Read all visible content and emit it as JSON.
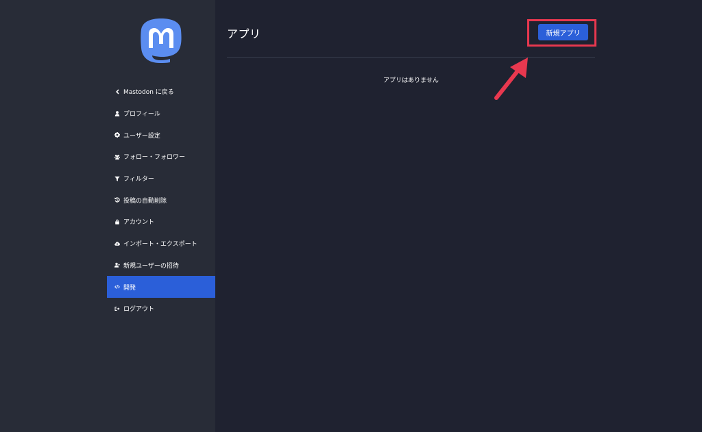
{
  "sidebar": {
    "logo_icon": "mastodon-logo-icon",
    "items": [
      {
        "label": "Mastodon に戻る",
        "icon": "chevron-left-icon",
        "active": false
      },
      {
        "label": "プロフィール",
        "icon": "user-icon",
        "active": false
      },
      {
        "label": "ユーザー設定",
        "icon": "gear-icon",
        "active": false
      },
      {
        "label": "フォロー・フォロワー",
        "icon": "users-icon",
        "active": false
      },
      {
        "label": "フィルター",
        "icon": "filter-icon",
        "active": false
      },
      {
        "label": "投稿の自動削除",
        "icon": "history-icon",
        "active": false
      },
      {
        "label": "アカウント",
        "icon": "lock-icon",
        "active": false
      },
      {
        "label": "インポート・エクスポート",
        "icon": "cloud-download-icon",
        "active": false
      },
      {
        "label": "新規ユーザーの招待",
        "icon": "user-plus-icon",
        "active": false
      },
      {
        "label": "開発",
        "icon": "code-icon",
        "active": true
      },
      {
        "label": "ログアウト",
        "icon": "sign-out-icon",
        "active": false
      }
    ]
  },
  "main": {
    "title": "アプリ",
    "new_app_label": "新規アプリ",
    "empty_message": "アプリはありません"
  },
  "colors": {
    "sidebar_bg": "#282c37",
    "main_bg": "#1f2230",
    "accent": "#2b5fd9",
    "annotation": "#e8384f"
  }
}
